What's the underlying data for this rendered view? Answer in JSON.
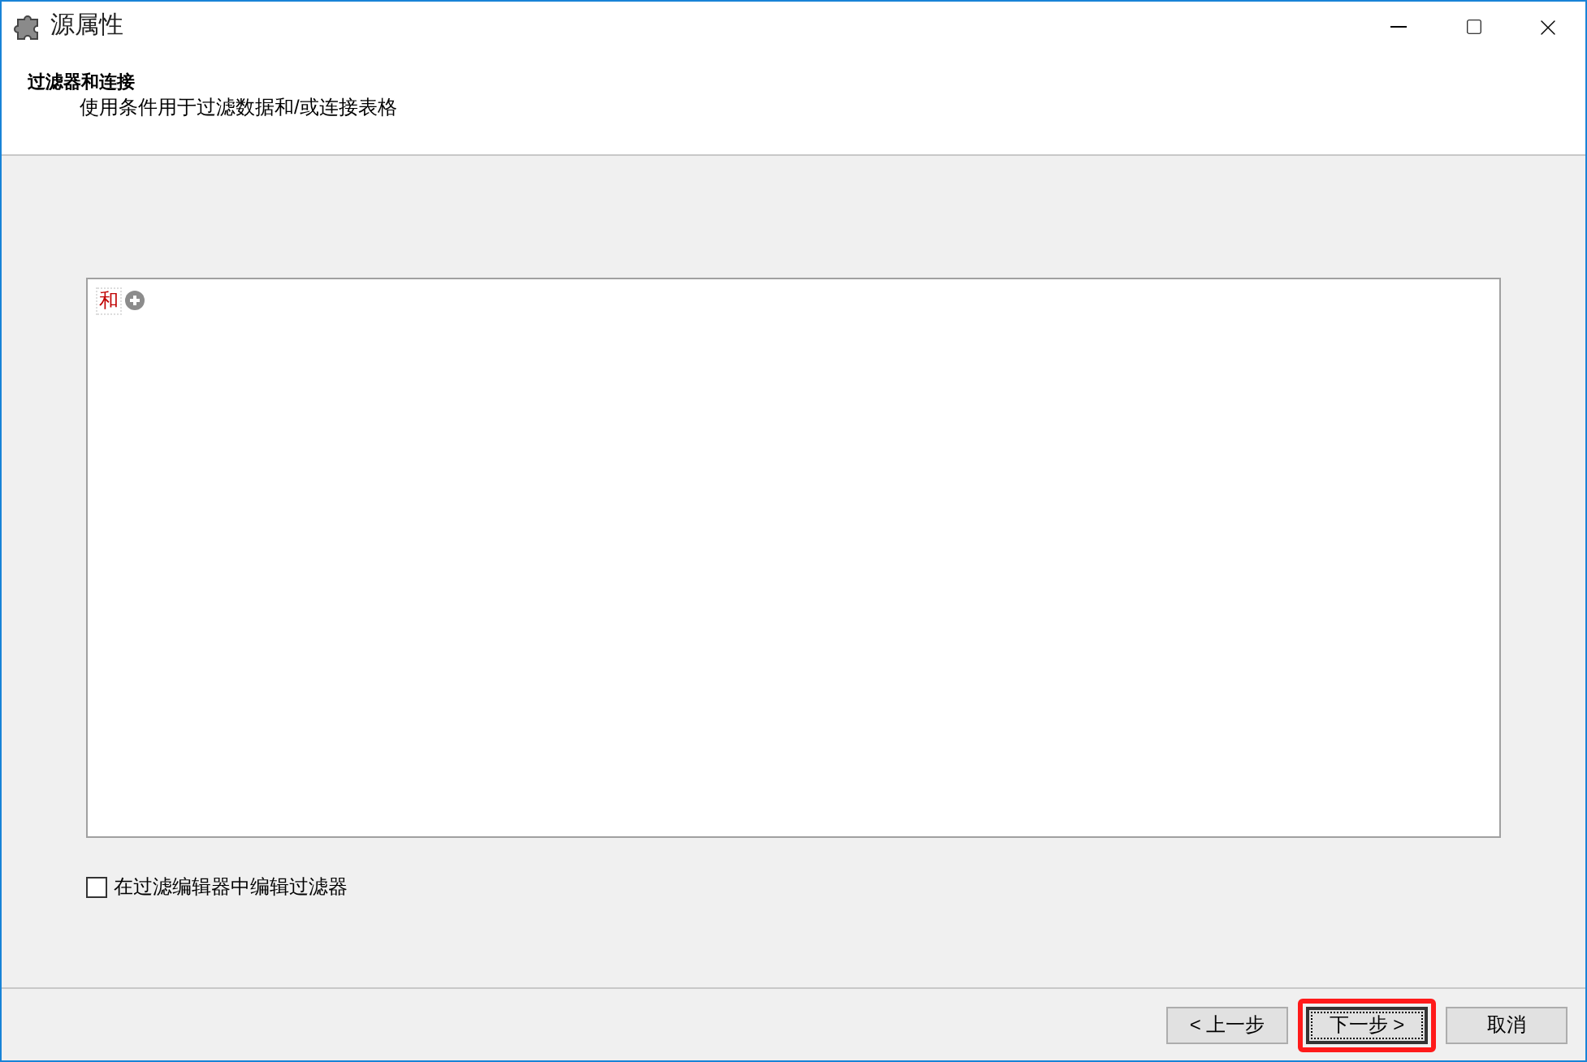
{
  "window": {
    "title": "源属性"
  },
  "header": {
    "title": "过滤器和连接",
    "subtitle": "使用条件用于过滤数据和/或连接表格"
  },
  "filter_editor": {
    "operator": "和"
  },
  "option": {
    "label": "在过滤编辑器中编辑过滤器",
    "checked": false
  },
  "buttons": [
    {
      "label": "< 上一步",
      "focused": false,
      "highlighted": false
    },
    {
      "label": "下一步 >",
      "focused": true,
      "highlighted": true
    },
    {
      "label": "取消",
      "focused": false,
      "highlighted": false
    }
  ]
}
